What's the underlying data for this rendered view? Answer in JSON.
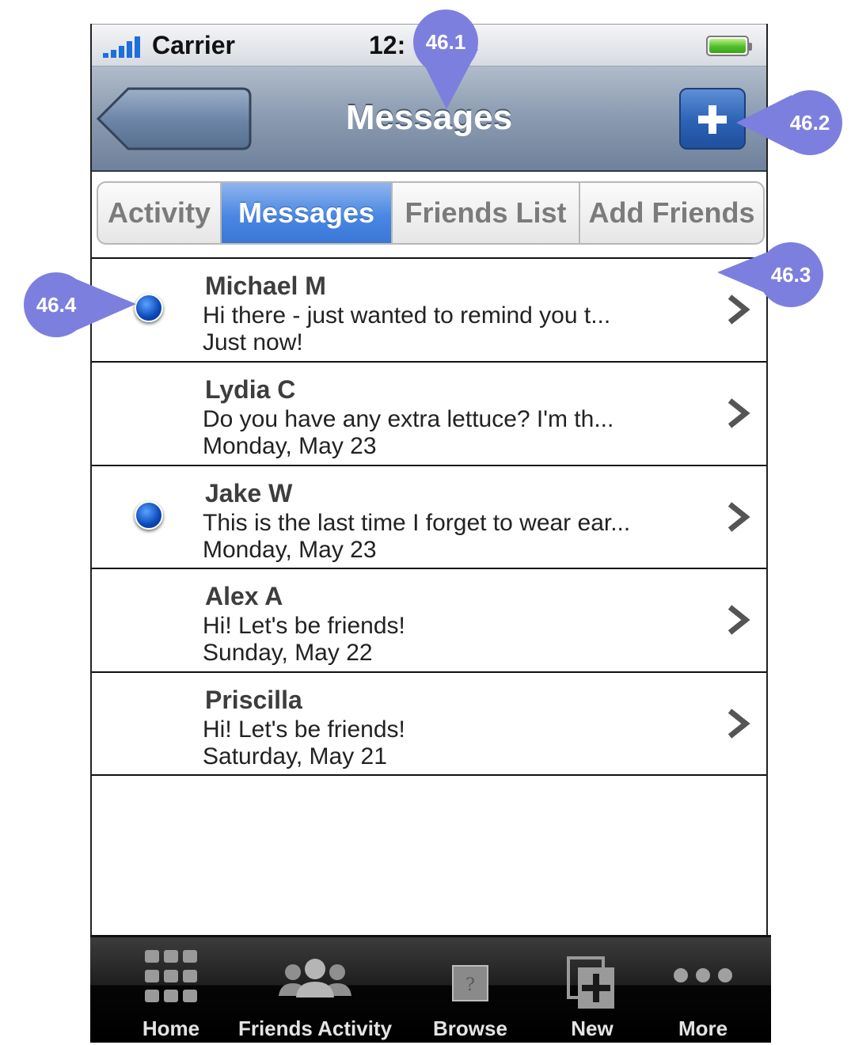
{
  "status_bar": {
    "carrier": "Carrier",
    "time": "12:"
  },
  "nav": {
    "title": "Messages"
  },
  "segments": [
    "Activity",
    "Messages",
    "Friends List",
    "Add Friends"
  ],
  "messages": [
    {
      "name": "Michael M",
      "preview": "Hi there - just wanted to remind you t...",
      "time": "Just now!",
      "unread": true
    },
    {
      "name": "Lydia C",
      "preview": "Do you have any extra lettuce? I'm th...",
      "time": "Monday, May 23",
      "unread": false
    },
    {
      "name": "Jake W",
      "preview": "This is the last time I forget to wear ear...",
      "time": "Monday, May 23",
      "unread": true
    },
    {
      "name": "Alex A",
      "preview": "Hi! Let's be friends!",
      "time": "Sunday, May 22",
      "unread": false
    },
    {
      "name": "Priscilla",
      "preview": "Hi! Let's be friends!",
      "time": "Saturday, May 21",
      "unread": false
    }
  ],
  "tabs": [
    "Home",
    "Friends Activity",
    "Browse",
    "New",
    "More"
  ],
  "callouts": {
    "c1": "46.1",
    "c2": "46.2",
    "c3": "46.3",
    "c4": "46.4"
  },
  "colors": {
    "accent": "#4a87e3",
    "unread_dot": "#0a47b8",
    "callout": "#7d7fdf"
  },
  "icons": [
    "signal-bars-icon",
    "battery-icon",
    "back-arrow-icon",
    "plus-icon",
    "chevron-right-icon",
    "grid-icon",
    "people-icon",
    "question-icon",
    "new-compose-icon",
    "more-dots-icon"
  ]
}
